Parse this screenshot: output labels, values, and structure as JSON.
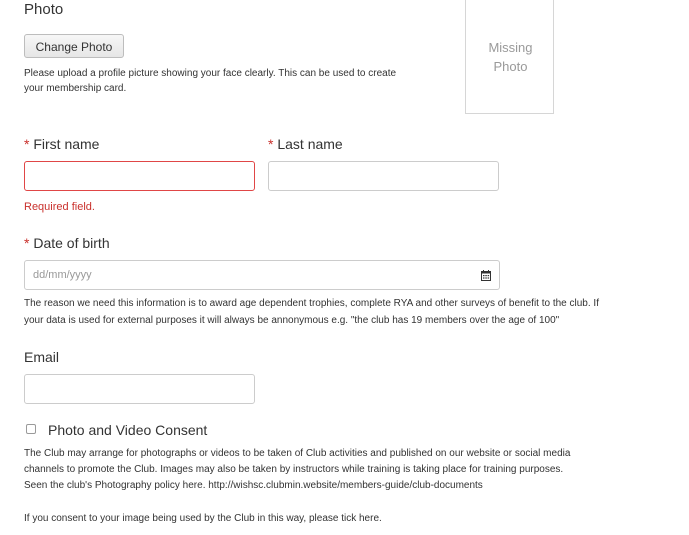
{
  "photo": {
    "label": "Photo",
    "change_button": "Change Photo",
    "help_line1": "Please upload a profile picture showing your face clearly. This can be used to create",
    "help_line2": "your membership card.",
    "missing_line1": "Missing",
    "missing_line2": "Photo"
  },
  "first_name": {
    "required_mark": "*",
    "label": "First name",
    "value": "",
    "error": "Required field."
  },
  "last_name": {
    "required_mark": "*",
    "label": "Last name",
    "value": ""
  },
  "dob": {
    "required_mark": "*",
    "label": "Date of birth",
    "placeholder": "dd/mm/yyyy",
    "icon": "calendar-icon",
    "help_line1": "The reason we need this information is to award age dependent trophies, complete RYA and other surveys of benefit to the club. If",
    "help_line2": "your data is used for external purposes it will always be annonymous e.g. \"the club has 19 members over the age of 100\""
  },
  "email": {
    "label": "Email",
    "value": ""
  },
  "consent": {
    "label": "Photo and Video Consent",
    "checked": false,
    "text_line1": "The Club may arrange for photographs or videos to be taken of Club activities and published on our website or social media",
    "text_line2": "channels to promote the Club. Images may also be taken by instructors while training is taking place for training purposes.",
    "text_line3": "Seen the club's Photography policy here. http://wishsc.clubmin.website/members-guide/club-documents",
    "tick_prompt": "If you consent to your image being used by the Club in this way, please tick here."
  },
  "colors": {
    "required": "#c9302c",
    "error_border": "#e04646",
    "border": "#cccccc",
    "text": "#333333"
  }
}
